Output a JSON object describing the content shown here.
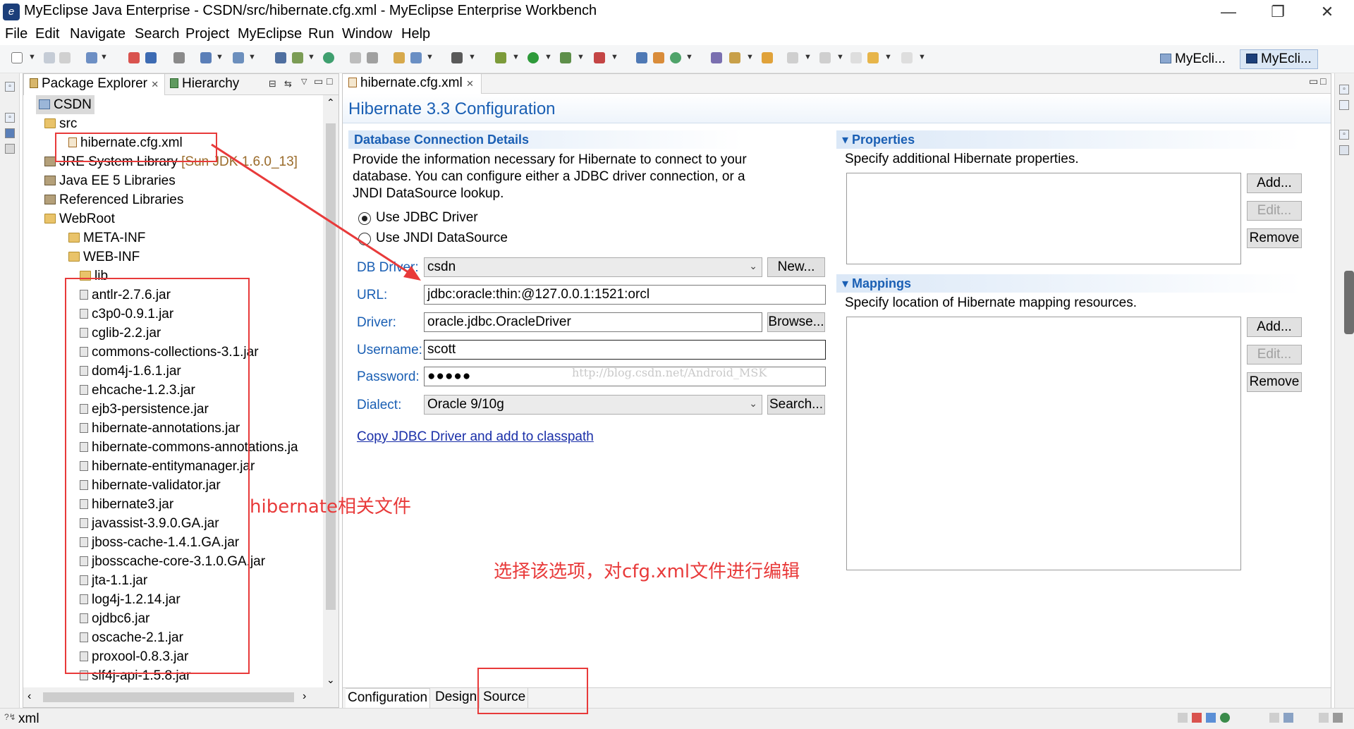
{
  "window": {
    "title": "MyEclipse Java Enterprise - CSDN/src/hibernate.cfg.xml - MyEclipse Enterprise Workbench",
    "controls": [
      "—",
      "❐",
      "✕"
    ]
  },
  "menu": [
    "File",
    "Edit",
    "Navigate",
    "Search",
    "Project",
    "MyEclipse",
    "Run",
    "Window",
    "Help"
  ],
  "perspectives": [
    "MyEcli...",
    "MyEcli..."
  ],
  "package_explorer": {
    "tabs": [
      "Package Explorer",
      "Hierarchy"
    ],
    "tree": [
      {
        "label": "CSDN",
        "icon": "project-icon"
      },
      {
        "label": "src",
        "icon": "package-folder-icon"
      },
      {
        "label": "hibernate.cfg.xml",
        "icon": "xml-file-icon"
      },
      {
        "label": "JRE System Library",
        "icon": "library-icon",
        "suffix": "[Sun JDK 1.6.0_13]"
      },
      {
        "label": "Java EE 5 Libraries",
        "icon": "library-icon"
      },
      {
        "label": "Referenced Libraries",
        "icon": "library-icon"
      },
      {
        "label": "WebRoot",
        "icon": "folder-icon"
      },
      {
        "label": "META-INF",
        "icon": "folder-icon"
      },
      {
        "label": "WEB-INF",
        "icon": "folder-icon"
      },
      {
        "label": "lib",
        "icon": "folder-icon"
      },
      {
        "label": "antlr-2.7.6.jar",
        "icon": "jar-icon"
      },
      {
        "label": "c3p0-0.9.1.jar",
        "icon": "jar-icon"
      },
      {
        "label": "cglib-2.2.jar",
        "icon": "jar-icon"
      },
      {
        "label": "commons-collections-3.1.jar",
        "icon": "jar-icon"
      },
      {
        "label": "dom4j-1.6.1.jar",
        "icon": "jar-icon"
      },
      {
        "label": "ehcache-1.2.3.jar",
        "icon": "jar-icon"
      },
      {
        "label": "ejb3-persistence.jar",
        "icon": "jar-icon"
      },
      {
        "label": "hibernate-annotations.jar",
        "icon": "jar-icon"
      },
      {
        "label": "hibernate-commons-annotations.ja",
        "icon": "jar-icon"
      },
      {
        "label": "hibernate-entitymanager.jar",
        "icon": "jar-icon"
      },
      {
        "label": "hibernate-validator.jar",
        "icon": "jar-icon"
      },
      {
        "label": "hibernate3.jar",
        "icon": "jar-icon"
      },
      {
        "label": "javassist-3.9.0.GA.jar",
        "icon": "jar-icon"
      },
      {
        "label": "jboss-cache-1.4.1.GA.jar",
        "icon": "jar-icon"
      },
      {
        "label": "jbosscache-core-3.1.0.GA.jar",
        "icon": "jar-icon"
      },
      {
        "label": "jta-1.1.jar",
        "icon": "jar-icon"
      },
      {
        "label": "log4j-1.2.14.jar",
        "icon": "jar-icon"
      },
      {
        "label": "ojdbc6.jar",
        "icon": "jar-icon"
      },
      {
        "label": "oscache-2.1.jar",
        "icon": "jar-icon"
      },
      {
        "label": "proxool-0.8.3.jar",
        "icon": "jar-icon"
      },
      {
        "label": "slf4j-api-1.5.8.jar",
        "icon": "jar-icon"
      }
    ]
  },
  "editor": {
    "tab": "hibernate.cfg.xml",
    "form_title": "Hibernate 3.3 Configuration",
    "db_section": {
      "title": "Database Connection Details",
      "description": "Provide the information necessary for Hibernate to connect to your database. You can configure either a JDBC driver connection, or a JNDI DataSource lookup.",
      "radio_jdbc": "Use JDBC Driver",
      "radio_jndi": "Use JNDI DataSource",
      "selected_mode": "jdbc",
      "db_driver_label": "DB Driver:",
      "db_driver_value": "csdn",
      "new_button": "New...",
      "url_label": "URL:",
      "url_value": "jdbc:oracle:thin:@127.0.0.1:1521:orcl",
      "driver_label": "Driver:",
      "driver_value": "oracle.jdbc.OracleDriver",
      "browse_button": "Browse...",
      "username_label": "Username:",
      "username_value": "scott",
      "password_label": "Password:",
      "password_value": "●●●●●",
      "dialect_label": "Dialect:",
      "dialect_value": "Oracle 9/10g",
      "search_button": "Search...",
      "copy_link": "Copy JDBC Driver and add to classpath",
      "watermark": "http://blog.csdn.net/Android_MSK"
    },
    "properties_section": {
      "title": "Properties",
      "description": "Specify additional Hibernate properties.",
      "add": "Add...",
      "edit": "Edit...",
      "remove": "Remove"
    },
    "mappings_section": {
      "title": "Mappings",
      "description": "Specify location of Hibernate mapping resources.",
      "add": "Add...",
      "edit": "Edit...",
      "remove": "Remove"
    },
    "bottom_tabs": [
      "Configuration",
      "Design",
      "Source"
    ],
    "active_bottom_tab": "Configuration"
  },
  "status_bar": {
    "text": "xml"
  },
  "annotations": {
    "files_note": "hibernate相关文件",
    "source_note": "选择该选项，对cfg.xml文件进行编辑",
    "color": "#e83a3a"
  }
}
